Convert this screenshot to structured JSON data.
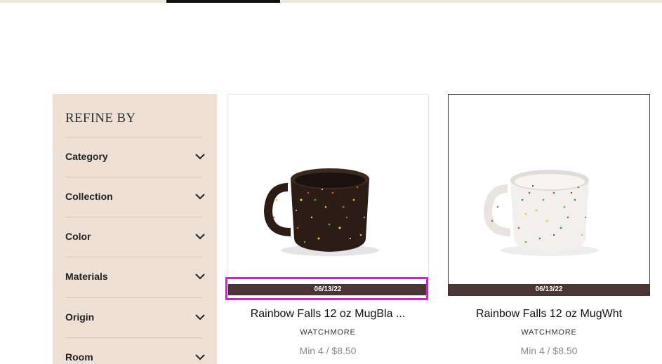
{
  "sidebar": {
    "title": "REFINE BY",
    "filters": [
      {
        "label": "Category"
      },
      {
        "label": "Collection"
      },
      {
        "label": "Color"
      },
      {
        "label": "Materials"
      },
      {
        "label": "Origin"
      },
      {
        "label": "Room"
      }
    ]
  },
  "products": [
    {
      "name": "Rainbow Falls 12 oz MugBla ...",
      "brand": "WATCHMORE",
      "price": "Min 4 / $8.50",
      "date": "06/13/22",
      "image": "black-speckled-mug",
      "mug_color": "#2b1d16"
    },
    {
      "name": "Rainbow Falls 12 oz MugWht",
      "brand": "WATCHMORE",
      "price": "Min 4 / $8.50",
      "date": "06/13/22",
      "image": "white-speckled-mug",
      "mug_color": "#f2f0ec"
    }
  ],
  "colors": {
    "sidebar_bg": "#eee0d4",
    "date_band": "#4a3535",
    "highlight": "#ff00ff"
  }
}
